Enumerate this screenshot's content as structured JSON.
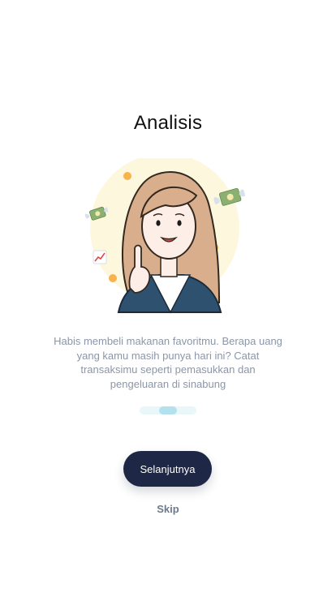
{
  "onboarding": {
    "title": "Analisis",
    "description": "Habis membeli makanan favoritmu. Berapa uang yang kamu masih punya hari ini? Catat transaksimu seperti pemasukkan dan pengeluaran di sinabung",
    "next_label": "Selanjutnya",
    "skip_label": "Skip",
    "pager": {
      "total_pages": 3,
      "current_page": 2
    },
    "illustration_icons": [
      "flying-money-icon",
      "chart-increasing-icon",
      "woman-pointing-illustration"
    ]
  },
  "colors": {
    "primary_button": "#1e2745",
    "text_muted": "#8b96a8",
    "skip_text": "#6c7a8d",
    "pager_active": "#b3e2ee",
    "pager_inactive": "#e2f3f9",
    "illustration_bg": "#fdf7de",
    "accent_dot": "#f7b24c"
  }
}
